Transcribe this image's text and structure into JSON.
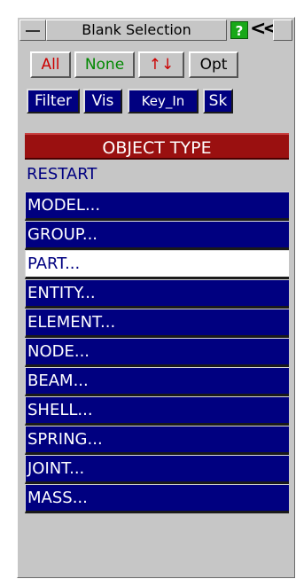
{
  "window": {
    "title": "Blank Selection",
    "help_label": "?",
    "collapse_label": "<<",
    "icons": [
      "minimize-icon",
      "help-icon",
      "collapse-icon",
      "maximize-icon"
    ]
  },
  "buttons": {
    "all": "All",
    "none": "None",
    "reverse": "↑↓",
    "opt": "Opt",
    "filter": "Filter",
    "vis": "Vis",
    "key_in": "Key_In",
    "sk": "Sk"
  },
  "colors": {
    "header_bg": "#9a1010",
    "item_bg": "#000080",
    "selected_bg": "#ffffff",
    "all_text": "#cc0000",
    "none_text": "#008800"
  },
  "object_type": {
    "header": "OBJECT TYPE",
    "restart": "RESTART",
    "items": [
      {
        "label": "MODEL...",
        "selected": false
      },
      {
        "label": "GROUP...",
        "selected": false
      },
      {
        "label": "PART...",
        "selected": true
      },
      {
        "label": "ENTITY...",
        "selected": false
      },
      {
        "label": "ELEMENT...",
        "selected": false
      },
      {
        "label": "NODE...",
        "selected": false
      },
      {
        "label": "BEAM...",
        "selected": false
      },
      {
        "label": "SHELL...",
        "selected": false
      },
      {
        "label": "SPRING...",
        "selected": false
      },
      {
        "label": "JOINT...",
        "selected": false
      },
      {
        "label": "MASS...",
        "selected": false
      }
    ]
  }
}
